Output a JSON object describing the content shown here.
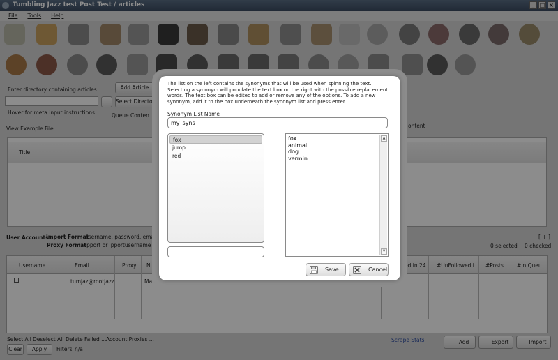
{
  "window": {
    "title": "Tumbling Jazz test Post Test / articles",
    "minimize": "_",
    "maximize": "□",
    "close": "×"
  },
  "menu": {
    "items": [
      "File",
      "Tools",
      "Help"
    ]
  },
  "background": {
    "directory_label": "Enter directory containing articles",
    "add_article_button": "Add Article",
    "select_directory_button": "Select Director",
    "queue_content_label": "Queue Conten",
    "hover_hint": "Hover for meta input instructions",
    "view_example_label": "View Example File",
    "content_label": "ontent",
    "title_column": "Title",
    "user_accounts_label": "User Accounts",
    "import_format_label": "Import Format",
    "import_format_value": "username, password, email,p",
    "proxy_format_label": "Proxy Format",
    "proxy_format_value": "ipport  or  ipportusername",
    "expand_link": "[ + ]",
    "selected_count": "0 selected",
    "checked_count": "0 checked",
    "columns": [
      "Username",
      "Email",
      "Proxy",
      "N",
      "ed in 24",
      "#UnFollowed i...",
      "#Posts",
      "#In Queu"
    ],
    "row_email": "tumjaz@rootjazz...",
    "row_ma": "Ma",
    "bottom_links": [
      "Select All",
      "Deselect All",
      "Delete Failed ...",
      "Account Proxies ..."
    ],
    "clear_button": "Clear",
    "apply_button": "Apply",
    "filters_label": "Filters",
    "filters_value": "n/a",
    "scrape_stats_link": "Scrape Stats",
    "add_button": "Add",
    "export_button": "Export",
    "import_button": "Import"
  },
  "dialog": {
    "instructions": "The list on the left contains the synonyms that will be used when spinning the text. Selecting a synonym will populate the text box on the right with the possible replacement words. The text box can be edited to add or remove any of the options. To add a new synonym, add it to the box underneath the synonym list and press enter.",
    "list_name_label": "Synonym List Name",
    "list_name_value": "my_syns",
    "synonyms": [
      "fox",
      "jump",
      "red"
    ],
    "selected_synonym": "fox",
    "replacements": [
      "fox",
      "animal",
      "dog",
      "vermin"
    ],
    "scroll_up": "▲",
    "scroll_down": "▼",
    "save_label": "Save",
    "cancel_label": "Cancel"
  }
}
